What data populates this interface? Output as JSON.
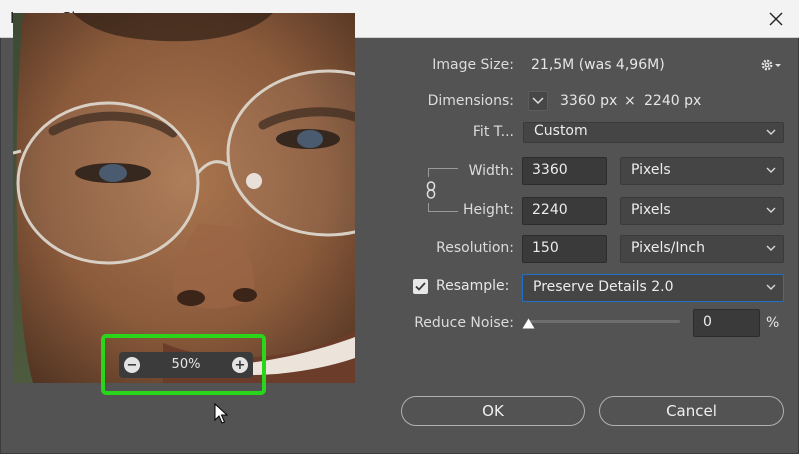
{
  "window": {
    "title": "Image Size"
  },
  "image_size": {
    "label": "Image Size:",
    "value": "21,5M (was 4,96M)"
  },
  "dimensions": {
    "label": "Dimensions:",
    "width": "3360 px",
    "times": "×",
    "height": "2240 px"
  },
  "fit_to": {
    "label": "Fit T...",
    "value": "Custom"
  },
  "width": {
    "label": "Width:",
    "value": "3360",
    "unit": "Pixels"
  },
  "height": {
    "label": "Height:",
    "value": "2240",
    "unit": "Pixels"
  },
  "resolution": {
    "label": "Resolution:",
    "value": "150",
    "unit": "Pixels/Inch"
  },
  "resample": {
    "label": "Resample:",
    "checked": true,
    "value": "Preserve Details 2.0"
  },
  "reduce_noise": {
    "label": "Reduce Noise:",
    "value": "0",
    "unit": "%",
    "level": 0
  },
  "zoom": {
    "value": "50%",
    "minus": "−",
    "plus": "+"
  },
  "buttons": {
    "ok": "OK",
    "cancel": "Cancel"
  },
  "icons": {
    "close": "close-icon",
    "gear": "gear-icon",
    "chevron": "chevron-down-icon",
    "link": "chain-link-icon",
    "check": "checkmark-icon",
    "cursor": "mouse-pointer-icon"
  },
  "colors": {
    "highlight": "#29d61a",
    "focus": "#1f70c9",
    "panel": "#535353"
  }
}
